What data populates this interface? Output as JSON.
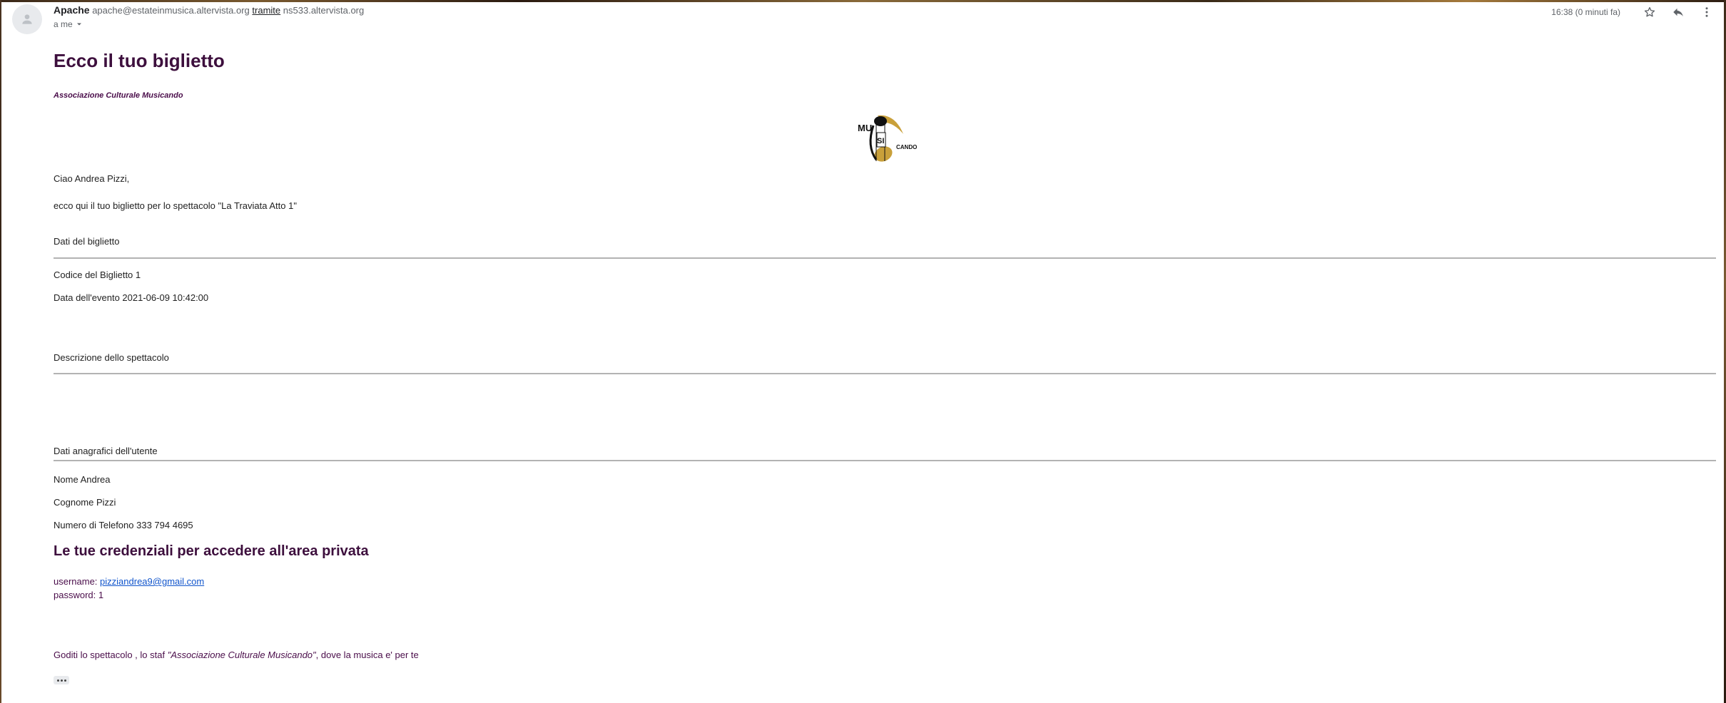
{
  "header": {
    "sender_name": "Apache",
    "sender_email": "apache@estateinmusica.altervista.org",
    "via_label": "tramite",
    "via_host": "ns533.altervista.org",
    "recipient": "a me",
    "timestamp": "16:38 (0 minuti fa)",
    "icons": [
      "star-icon",
      "reply-icon",
      "more-vert-icon"
    ]
  },
  "email": {
    "title": "Ecco il tuo biglietto",
    "organization": "Associazione Culturale Musicando",
    "logo": {
      "text_mu": "MU",
      "text_si": "SI",
      "text_cando": "CANDO",
      "accent_color": "#c9a03a"
    },
    "greeting": "Ciao Andrea Pizzi,",
    "intro": "ecco qui il tuo biglietto per lo spettacolo \"La Traviata Atto 1\"",
    "ticket_section": {
      "heading": "Dati del biglietto",
      "code": "Codice del Biglietto 1",
      "event_date": "Data dell'evento 2021-06-09 10:42:00"
    },
    "description_section": {
      "heading": "Descrizione dello spettacolo"
    },
    "user_section": {
      "heading": "Dati anagrafici dell'utente",
      "name": "Nome Andrea",
      "surname": "Cognome Pizzi",
      "phone": "Numero di Telefono 333 794 4695"
    },
    "credentials": {
      "heading": "Le tue credenziali per accedere all'area privata",
      "username_label": "username: ",
      "username_value": "pizziandrea9@gmail.com",
      "password_line": "password: 1"
    },
    "closing": {
      "prefix": "Goditi lo spettacolo , lo staf ",
      "org_quoted": "\"Associazione Culturale Musicando\"",
      "suffix": ", dove la musica e' per te"
    }
  },
  "colors": {
    "title": "#3d0f3d",
    "text": "#222222",
    "link": "#1155cc"
  }
}
